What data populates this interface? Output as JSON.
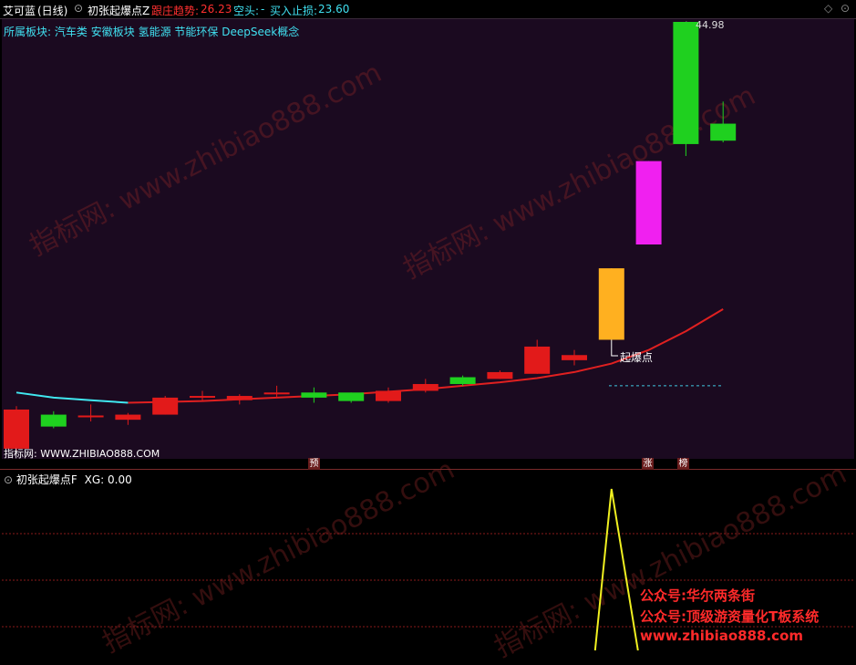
{
  "header": {
    "stock_name": "艾可蓝",
    "period": "(日线)",
    "indicator_name": "初张起爆点Z",
    "trend_label": "跟庄趋势:",
    "trend_value": "26.23",
    "short_label": "空头:",
    "short_value": "-",
    "stop_label": "买入止损:",
    "stop_value": "23.60"
  },
  "sector": {
    "prefix": "所属板块:",
    "items": [
      "汽车类",
      "安徽板块",
      "氢能源",
      "节能环保",
      "DeepSeek概念"
    ]
  },
  "chart": {
    "max_price_label": "44.98",
    "signal_label": "起爆点",
    "bottom_left_label": "指标网: WWW.ZHIBIAO888.COM"
  },
  "signal_tags": [
    "预",
    "涨",
    "榜"
  ],
  "indicator_panel": {
    "title": "初张起爆点F",
    "xg_label": "XG:",
    "xg_value": "0.00"
  },
  "watermark": [
    "指标网: www.zhibiao888.com"
  ],
  "promo": {
    "line1": "公众号:华尔两条街",
    "line2": "公众号:顶级游资量化T板系统",
    "line3": "www.zhibiao888.com"
  },
  "colors": {
    "up": "#e21a1a",
    "down": "#1fd01f",
    "magenta": "#f020f0",
    "orange": "#ffb020",
    "trend_line": "#e02020",
    "cyan_line": "#40e8f0",
    "xg_line": "#f0f020",
    "accent_cyan": "#40e0f0"
  },
  "chart_data": {
    "type": "candlestick",
    "price_unit": "CNY",
    "candles": [
      {
        "o": 22.2,
        "h": 22.4,
        "l": 19.8,
        "c": 19.9,
        "color": "up"
      },
      {
        "o": 21.9,
        "h": 22.1,
        "l": 21.1,
        "c": 21.2,
        "color": "down"
      },
      {
        "o": 21.85,
        "h": 22.5,
        "l": 21.5,
        "c": 21.8,
        "color": "up"
      },
      {
        "o": 21.9,
        "h": 22.0,
        "l": 21.3,
        "c": 21.6,
        "color": "up"
      },
      {
        "o": 22.9,
        "h": 23.0,
        "l": 21.9,
        "c": 21.9,
        "color": "up"
      },
      {
        "o": 23.0,
        "h": 23.3,
        "l": 22.7,
        "c": 23.0,
        "color": "up"
      },
      {
        "o": 23.0,
        "h": 23.1,
        "l": 22.5,
        "c": 22.75,
        "color": "up"
      },
      {
        "o": 23.1,
        "h": 23.6,
        "l": 22.9,
        "c": 23.2,
        "color": "up"
      },
      {
        "o": 23.2,
        "h": 23.5,
        "l": 22.6,
        "c": 22.9,
        "color": "down"
      },
      {
        "o": 23.2,
        "h": 23.2,
        "l": 22.6,
        "c": 22.7,
        "color": "down"
      },
      {
        "o": 23.3,
        "h": 23.5,
        "l": 22.6,
        "c": 22.7,
        "color": "up"
      },
      {
        "o": 23.7,
        "h": 24.0,
        "l": 23.2,
        "c": 23.3,
        "color": "up"
      },
      {
        "o": 24.1,
        "h": 24.2,
        "l": 23.6,
        "c": 23.7,
        "color": "down"
      },
      {
        "o": 24.4,
        "h": 24.5,
        "l": 24.0,
        "c": 24.0,
        "color": "up"
      },
      {
        "o": 25.9,
        "h": 26.3,
        "l": 24.3,
        "c": 24.3,
        "color": "up"
      },
      {
        "o": 25.4,
        "h": 25.7,
        "l": 24.8,
        "c": 25.1,
        "color": "up"
      },
      {
        "o": 30.5,
        "h": 30.5,
        "l": 26.3,
        "c": 26.3,
        "color": "orange"
      },
      {
        "o": 36.8,
        "h": 36.8,
        "l": 31.9,
        "c": 31.9,
        "color": "magenta"
      },
      {
        "o": 44.98,
        "h": 44.98,
        "l": 37.1,
        "c": 37.8,
        "color": "down"
      },
      {
        "o": 39.0,
        "h": 40.3,
        "l": 37.9,
        "c": 38.0,
        "color": "down"
      }
    ],
    "trend_line": [
      22.6,
      22.6,
      22.6,
      22.6,
      22.65,
      22.7,
      22.8,
      22.9,
      23.0,
      23.1,
      23.25,
      23.4,
      23.6,
      23.8,
      24.05,
      24.4,
      24.9,
      25.7,
      26.8,
      28.1
    ],
    "cyan_line": [
      23.2,
      22.9,
      22.75,
      22.6
    ],
    "xg_peak_index": 16
  }
}
